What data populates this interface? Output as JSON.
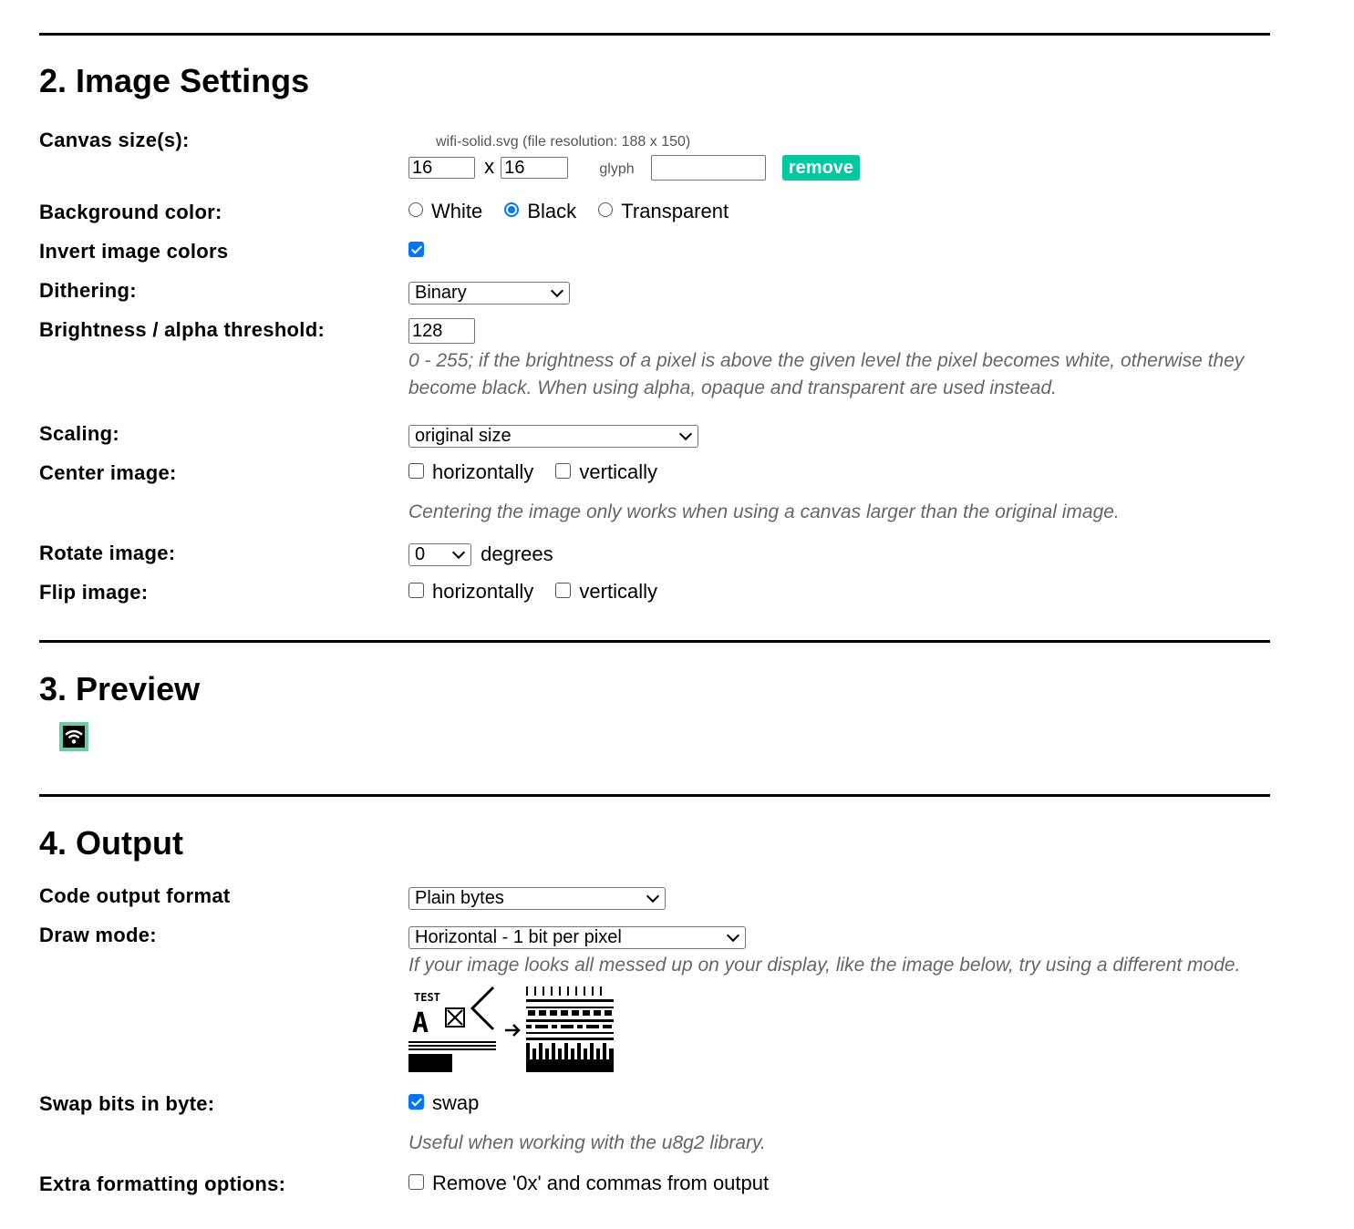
{
  "sections": {
    "image_settings": "2. Image Settings",
    "preview": "3. Preview",
    "output": "4. Output"
  },
  "canvas": {
    "label": "Canvas size(s):",
    "file_info": "wifi-solid.svg (file resolution: 188 x 150)",
    "width": "16",
    "x": "x",
    "height": "16",
    "glyph_label": "glyph",
    "glyph_value": "",
    "remove": "remove"
  },
  "background": {
    "label": "Background color:",
    "options": [
      "White",
      "Black",
      "Transparent"
    ],
    "selected": "Black"
  },
  "invert": {
    "label": "Invert image colors",
    "checked": true
  },
  "dithering": {
    "label": "Dithering:",
    "value": "Binary"
  },
  "brightness": {
    "label": "Brightness / alpha threshold:",
    "value": "128",
    "note_line1": "0 - 255; if the brightness of a pixel is above the given level the pixel becomes white, otherwise they",
    "note_line2": "become black. When using alpha, opaque and transparent are used instead."
  },
  "scaling": {
    "label": "Scaling:",
    "value": "original size"
  },
  "center": {
    "label": "Center image:",
    "horizontally": "horizontally",
    "vertically": "vertically",
    "note": "Centering the image only works when using a canvas larger than the original image."
  },
  "rotate": {
    "label": "Rotate image:",
    "value": "0",
    "unit": "degrees"
  },
  "flip": {
    "label": "Flip image:",
    "horizontally": "horizontally",
    "vertically": "vertically"
  },
  "output": {
    "format_label": "Code output format",
    "format_value": "Plain bytes",
    "draw_label": "Draw mode:",
    "draw_value": "Horizontal - 1 bit per pixel",
    "draw_note": "If your image looks all messed up on your display, like the image below, try using a different mode.",
    "example_text": "TEST",
    "example_letter": "A",
    "swap_label": "Swap bits in byte:",
    "swap_option": "swap",
    "swap_checked": true,
    "swap_note": "Useful when working with the u8g2 library.",
    "extra_label": "Extra formatting options:",
    "extra_option": "Remove '0x' and commas from output",
    "extra_checked": false
  },
  "colors": {
    "accent": "#0075ff",
    "remove_button": "#00c9a0",
    "preview_border": "#66ccaa",
    "note_text": "#666666"
  }
}
